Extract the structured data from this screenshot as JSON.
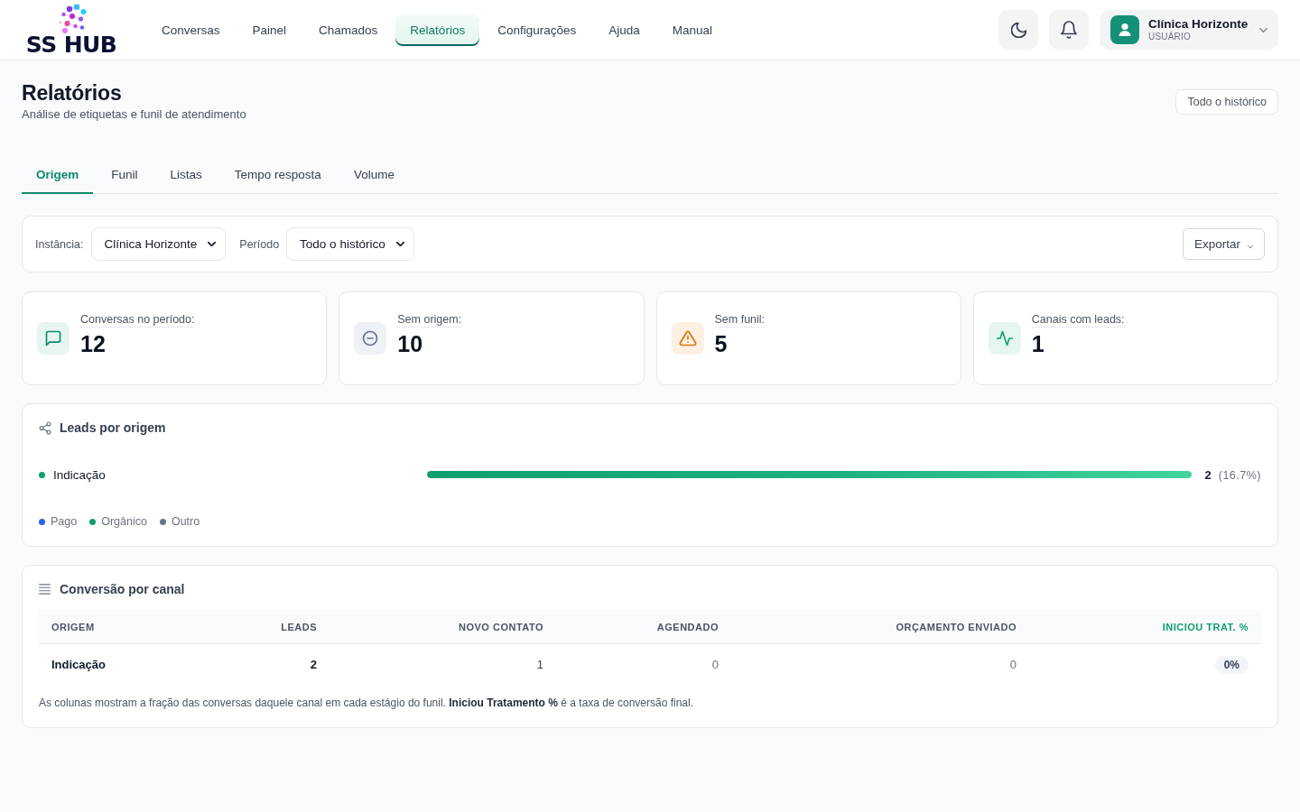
{
  "header": {
    "logo": "SS HUB",
    "nav": [
      {
        "label": "Conversas",
        "selected": false
      },
      {
        "label": "Painel",
        "selected": false
      },
      {
        "label": "Chamados",
        "selected": false
      },
      {
        "label": "Relatórios",
        "selected": true
      },
      {
        "label": "Configurações",
        "selected": false
      },
      {
        "label": "Ajuda",
        "selected": false
      },
      {
        "label": "Manual",
        "selected": false
      }
    ],
    "user": {
      "name": "Clínica Horizonte",
      "role": "USUÁRIO"
    }
  },
  "page": {
    "title": "Relatórios",
    "subtitle": "Análise de etiquetas e funil de atendimento",
    "range_chip": "Todo o histórico"
  },
  "tabs": [
    {
      "label": "Origem",
      "selected": true
    },
    {
      "label": "Funil",
      "selected": false
    },
    {
      "label": "Listas",
      "selected": false
    },
    {
      "label": "Tempo resposta",
      "selected": false
    },
    {
      "label": "Volume",
      "selected": false
    }
  ],
  "filters": {
    "instance_label": "Instância:",
    "instance_value": "Clínica Horizonte",
    "period_label": "Período",
    "period_value": "Todo o histórico",
    "export_button": "Exportar"
  },
  "stats": [
    {
      "kind": "chat",
      "label": "Conversas no período:",
      "value": "12"
    },
    {
      "kind": "minus",
      "label": "Sem origem:",
      "value": "10"
    },
    {
      "kind": "warning",
      "label": "Sem funil:",
      "value": "5"
    },
    {
      "kind": "activity",
      "label": "Canais com leads:",
      "value": "1"
    }
  ],
  "leads_by_origin": {
    "title": "Leads por origem",
    "rows": [
      {
        "label": "Indicação",
        "color": "#0e9f6e",
        "level": 1,
        "count": "2",
        "share": "(16.7%)"
      }
    ],
    "legend": [
      {
        "label": "Pago",
        "color": "#2563eb"
      },
      {
        "label": "Orgânico",
        "color": "#0e9f6e"
      },
      {
        "label": "Outro",
        "color": "#64748b"
      }
    ]
  },
  "conversion": {
    "title": "Conversão por canal",
    "columns": [
      {
        "label": "ORIGEM",
        "highlighted": false
      },
      {
        "label": "LEADS",
        "highlighted": false
      },
      {
        "label": "NOVO CONTATO",
        "highlighted": false
      },
      {
        "label": "AGENDADO",
        "highlighted": false
      },
      {
        "label": "ORÇAMENTO ENVIADO",
        "highlighted": false
      },
      {
        "label": "INICIOU TRAT. %",
        "highlighted": true
      }
    ],
    "rows": [
      {
        "cells": [
          "Indicação",
          "2",
          "1",
          "0",
          "0",
          "0%"
        ]
      }
    ],
    "footnote": "As colunas mostram a fração das conversas daquele canal em cada estágio do funil. **Iniciou Tratamento %** é a taxa de conversão final."
  }
}
